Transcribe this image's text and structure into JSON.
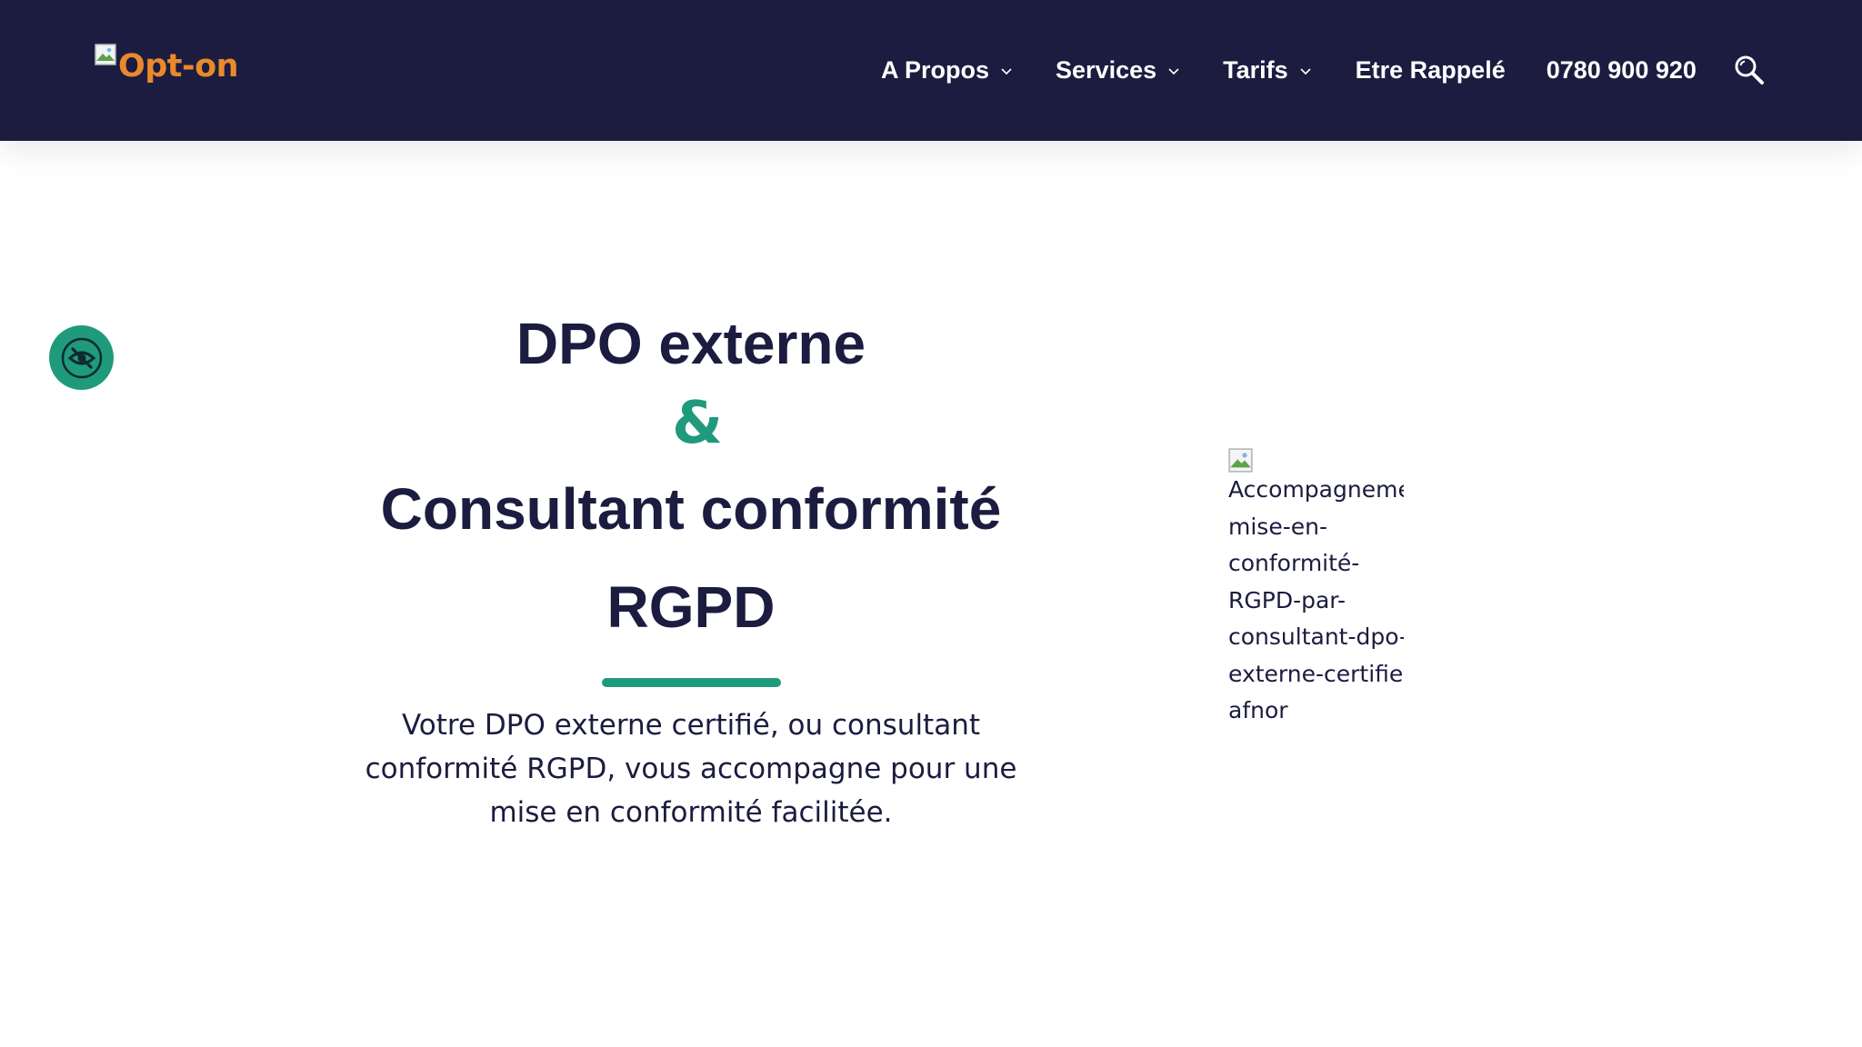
{
  "header": {
    "logo_text": "Opt-on",
    "nav": [
      {
        "label": "A Propos",
        "has_dropdown": true
      },
      {
        "label": "Services",
        "has_dropdown": true
      },
      {
        "label": "Tarifs",
        "has_dropdown": true
      },
      {
        "label": "Etre Rappelé",
        "has_dropdown": false
      },
      {
        "label": "0780 900 920",
        "has_dropdown": false
      }
    ],
    "search_icon": "search-icon"
  },
  "accessibility": {
    "icon": "eye-slash-icon"
  },
  "hero": {
    "title_line1": "DPO externe",
    "ampersand": "&",
    "title_line2": "Consultant conformité",
    "title_line3": "RGPD",
    "subtitle": "Votre DPO externe certifié, ou consultant conformité RGPD, vous accompagne pour une mise en conformité facilitée.",
    "image_alt_lines": [
      "Accompagnement-",
      "mise-en-",
      "conformité-",
      "RGPD-par-",
      "consultant-dpo-",
      "externe-certifie-",
      "afnor"
    ]
  },
  "colors": {
    "header_bg": "#1b1c3f",
    "accent": "#1f9a7c",
    "logo": "#e8892c",
    "text": "#1b1c3f"
  }
}
